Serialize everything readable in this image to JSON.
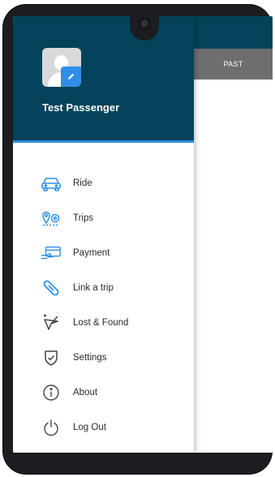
{
  "tabs": {
    "past_label": "PAST"
  },
  "drawer": {
    "user_name": "Test Passenger"
  },
  "menu": [
    {
      "label": "Ride",
      "icon": "car-icon",
      "color": "#2f8fe8"
    },
    {
      "label": "Trips",
      "icon": "map-pins-icon",
      "color": "#2f8fe8"
    },
    {
      "label": "Payment",
      "icon": "payment-card-icon",
      "color": "#2f8fe8"
    },
    {
      "label": "Link a trip",
      "icon": "link-icon",
      "color": "#2f8fe8"
    },
    {
      "label": "Lost & Found",
      "icon": "lost-found-icon",
      "color": "#444444"
    },
    {
      "label": "Settings",
      "icon": "shield-check-icon",
      "color": "#444444"
    },
    {
      "label": "About",
      "icon": "info-icon",
      "color": "#444444"
    },
    {
      "label": "Log Out",
      "icon": "power-icon",
      "color": "#444444"
    }
  ],
  "colors": {
    "header": "#04435a",
    "accent": "#2f8fe8",
    "tab": "#6e6e6e"
  }
}
